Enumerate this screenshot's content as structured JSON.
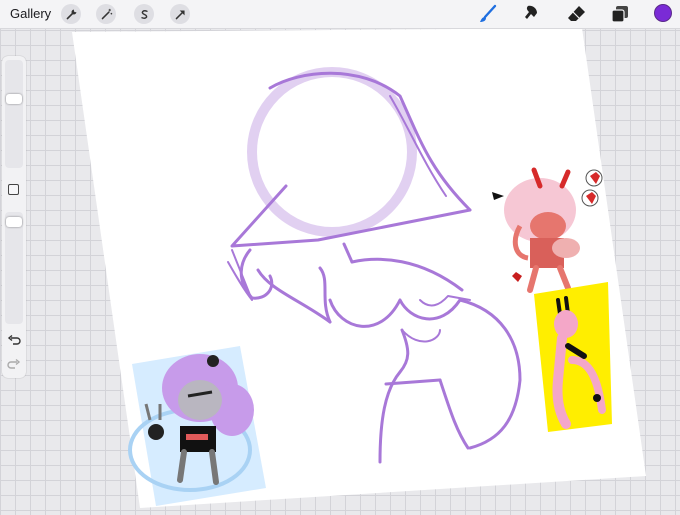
{
  "topbar": {
    "gallery_label": "Gallery",
    "left_tools": [
      "wrench-icon",
      "magic-wand-icon",
      "selection-s-icon",
      "transform-arrow-icon"
    ],
    "right_tools": [
      "brush-icon",
      "smudge-icon",
      "eraser-icon",
      "layers-icon"
    ],
    "active_tool": "brush",
    "current_color": "#7a2bd6",
    "brush_active_color": "#1f6fe0"
  },
  "sidebar": {
    "size_slider_level": 0.65,
    "opacity_slider_level": 0.05,
    "undo_icon": "undo-icon",
    "redo_icon": "redo-icon"
  },
  "canvas": {
    "sketch_color": "#a878d8",
    "refs": [
      "pink-haired-reference",
      "horned-demon-reference",
      "bunny-reference"
    ]
  }
}
